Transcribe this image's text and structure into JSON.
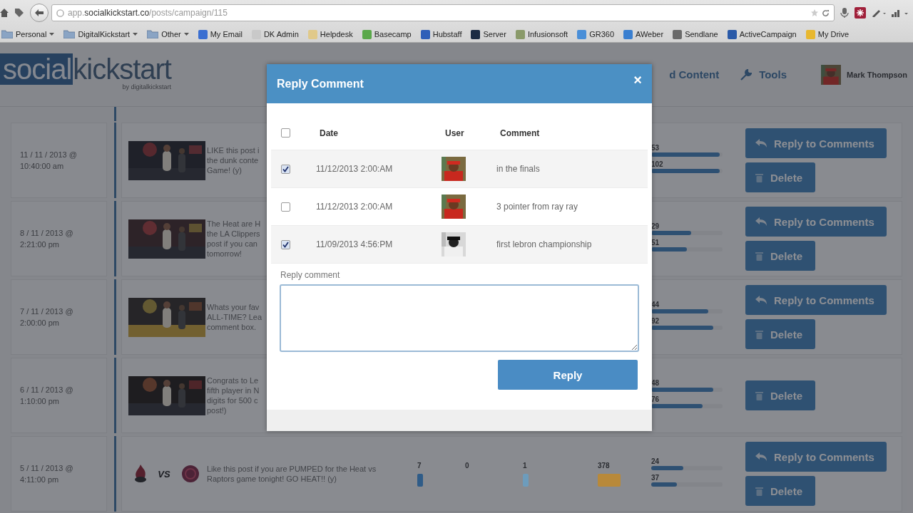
{
  "browser": {
    "address": "app.**socialkickstart.co**/posts/campaign/115",
    "bookmarks": [
      {
        "label": "Personal",
        "kind": "folder",
        "menu": true
      },
      {
        "label": "DigitalKickstart",
        "kind": "folder",
        "menu": true
      },
      {
        "label": "Other",
        "kind": "folder",
        "menu": true
      },
      {
        "label": "My Email",
        "kind": "link",
        "menu": false,
        "color": "#3b6fd1"
      },
      {
        "label": "DK Admin",
        "kind": "link",
        "menu": false,
        "color": "#c9c9c9"
      },
      {
        "label": "Helpdesk",
        "kind": "link",
        "menu": false,
        "color": "#e0c98a"
      },
      {
        "label": "Basecamp",
        "kind": "link",
        "menu": false,
        "color": "#5aa84a"
      },
      {
        "label": "Hubstaff",
        "kind": "link",
        "menu": false,
        "color": "#2f5fb8"
      },
      {
        "label": "Server",
        "kind": "link",
        "menu": false,
        "color": "#1c2c44"
      },
      {
        "label": "Infusionsoft",
        "kind": "link",
        "menu": false,
        "color": "#8a9a6a"
      },
      {
        "label": "GR360",
        "kind": "link",
        "menu": false,
        "color": "#4a8fd8"
      },
      {
        "label": "AWeber",
        "kind": "link",
        "menu": false,
        "color": "#3a7fd0"
      },
      {
        "label": "Sendlane",
        "kind": "link",
        "menu": false,
        "color": "#6a6a6a"
      },
      {
        "label": "ActiveCampaign",
        "kind": "link",
        "menu": false,
        "color": "#2a5aa8"
      },
      {
        "label": "My Drive",
        "kind": "link",
        "menu": false,
        "color": "#e8b830"
      }
    ]
  },
  "header": {
    "logo": {
      "part1": "social",
      "part2": "kickstart",
      "tagline": "by digitalkickstart"
    },
    "nav": [
      {
        "label": "d Content",
        "icon": false
      },
      {
        "label": "Tools",
        "icon": true
      }
    ],
    "user": "Mark Thompson"
  },
  "posts": [
    {
      "date": "11 / 11 / 2013 @",
      "time": "10:40:00 am",
      "text": [
        "LIKE this post i",
        "the dunk conte",
        "Game! (y)"
      ],
      "stats": [
        {
          "value": "53",
          "level": 0.96
        },
        {
          "value": "102",
          "level": 0.96
        }
      ],
      "reply_button": "Reply to Comments",
      "delete_button": "Delete"
    },
    {
      "date": "8 / 11 / 2013 @",
      "time": "2:21:00 pm",
      "text": [
        "The Heat are H",
        "the LA Clippers",
        "post if you can",
        "tomorrow!"
      ],
      "stats": [
        {
          "value": "29",
          "level": 0.56
        },
        {
          "value": "51",
          "level": 0.5
        }
      ],
      "reply_button": "Reply to Comments",
      "delete_button": "Delete"
    },
    {
      "date": "7 / 11 / 2013 @",
      "time": "2:00:00 pm",
      "text": [
        "Whats your fav",
        "ALL-TIME? Lea",
        "comment box."
      ],
      "stats": [
        {
          "value": "44",
          "level": 0.8
        },
        {
          "value": "92",
          "level": 0.87
        }
      ],
      "reply_button": "Reply to Comments",
      "delete_button": "Delete"
    },
    {
      "date": "6 / 11 / 2013 @",
      "time": "1:10:00 pm",
      "text": [
        "Congrats to Le",
        "fifth player in N",
        "digits for 500 c",
        "post!)"
      ],
      "stats": [
        {
          "value": "48",
          "level": 0.87
        },
        {
          "value": "76",
          "level": 0.72
        }
      ],
      "delete_button": "Delete"
    },
    {
      "date": "5 / 11 / 2013 @",
      "time": "4:11:00 pm",
      "kind": "matchup",
      "versus": "VS",
      "text": [
        "Like this post if you are PUMPED for the Heat vs Raptors game tonight! GO HEAT!! (y)"
      ],
      "metrics": [
        {
          "value": "7",
          "color": "#2f5c88"
        },
        {
          "value": "0"
        },
        {
          "value": "1",
          "color": "#6d9cbc"
        },
        {
          "value": "378",
          "color": "#b8893a"
        }
      ],
      "stats": [
        {
          "value": "24",
          "level": 0.45
        },
        {
          "value": "37",
          "level": 0.36
        }
      ],
      "reply_button": "Reply to Comments",
      "delete_button": "Delete"
    }
  ],
  "dialog": {
    "title": "Reply Comment",
    "close": "×",
    "columns": [
      "Date",
      "User",
      "Comment"
    ],
    "select_all_checked": false,
    "rows": [
      {
        "checked": true,
        "date": "11/12/2013 2:00:AM",
        "comment": "in the finals"
      },
      {
        "checked": false,
        "date": "11/12/2013 2:00:AM",
        "comment": "3 pointer from ray ray"
      },
      {
        "checked": true,
        "date": "11/09/2013 4:56:PM",
        "comment": "first lebron championship"
      }
    ],
    "reply_label": "Reply comment",
    "submit": "Reply"
  }
}
